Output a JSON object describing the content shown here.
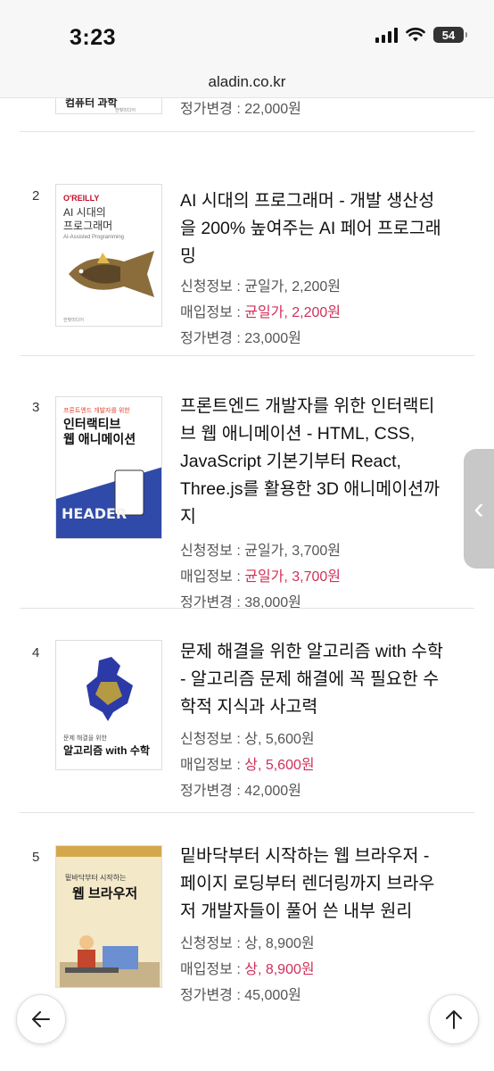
{
  "status_bar": {
    "time": "3:23",
    "battery": "54"
  },
  "url_bar": {
    "domain": "aladin.co.kr"
  },
  "labels": {
    "apply": "신청정보 : ",
    "buy": "매입정보 : ",
    "price": "정가변경 : "
  },
  "top_partial": {
    "price": "22,000원"
  },
  "items": [
    {
      "rank": "2",
      "title": "AI 시대의 프로그래머 - 개발 생산성을 200% 높여주는 AI 페어 프로그래밍",
      "apply": "균일가, 2,200원",
      "buy": "균일가, 2,200원",
      "price": "23,000원",
      "cover": {
        "publisher": "O'REILLY",
        "title_line1": "AI 시대의",
        "title_line2": "프로그래머",
        "subtitle": "AI-Assisted Programming",
        "bg": "#ffffff",
        "accent": "#6d5a3c"
      }
    },
    {
      "rank": "3",
      "title": "프론트엔드 개발자를 위한 인터랙티브 웹 애니메이션 - HTML, CSS, JavaScript 기본기부터 React, Three.js를 활용한 3D 애니메이션까지",
      "apply": "균일가, 3,700원",
      "buy": "균일가, 3,700원",
      "price": "38,000원",
      "cover": {
        "kicker": "프론트엔드 개발자를 위한",
        "title_line1": "인터랙티브",
        "title_line2": "웹 애니메이션",
        "bg": "#ffffff",
        "accent": "#3f6fd6"
      }
    },
    {
      "rank": "4",
      "title": "문제 해결을 위한 알고리즘 with 수학 - 알고리즘 문제 해결에 꼭 필요한 수학적 지식과 사고력",
      "apply": "상, 5,600원",
      "buy": "상, 5,600원",
      "price": "42,000원",
      "cover": {
        "kicker": "문제 해결을 위한",
        "title_line1": "알고리즘 with 수학",
        "bg": "#ffffff",
        "accent": "#2b3aa6"
      }
    },
    {
      "rank": "5",
      "title": "밑바닥부터 시작하는 웹 브라우저 - 페이지 로딩부터 렌더링까지 브라우저 개발자들이 풀어 쓴 내부 원리",
      "apply": "상, 8,900원",
      "buy": "상, 8,900원",
      "price": "45,000원",
      "cover": {
        "kicker": "밑바닥부터 시작하는",
        "title_line1": "웹 브라우저",
        "bg": "#f3e8c8",
        "accent": "#c2472e"
      }
    }
  ],
  "colors": {
    "buy_highlight": "#d0305a",
    "side_handle": "#c8c8c8"
  },
  "icons": {
    "back": "arrow-left-icon",
    "top": "arrow-up-icon",
    "handle": "chevron-left-icon"
  }
}
